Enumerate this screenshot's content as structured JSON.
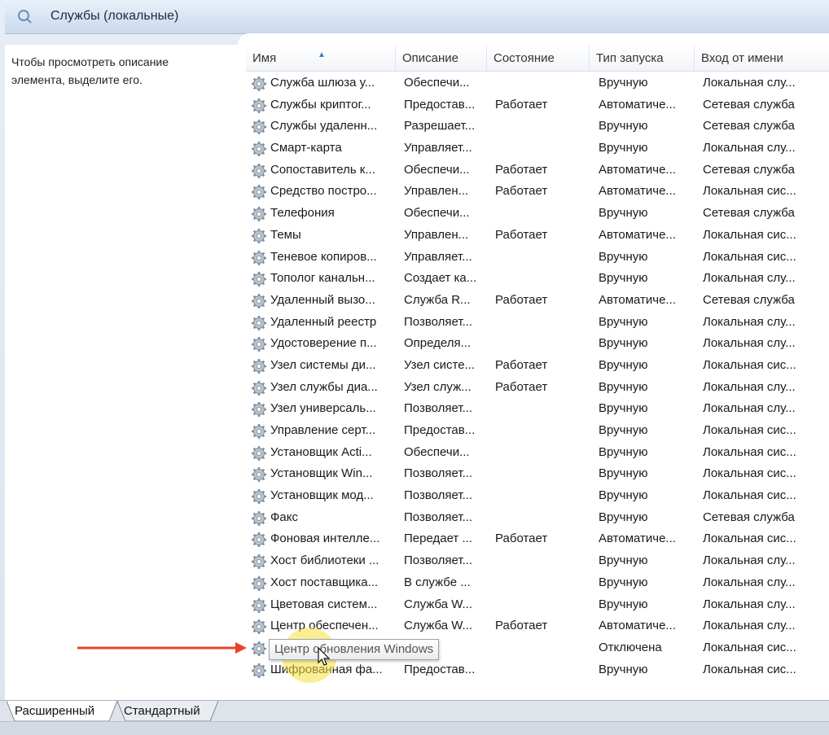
{
  "window": {
    "title": "Службы (локальные)"
  },
  "left_pane": {
    "description": "Чтобы просмотреть описание\nэлемента, выделите его."
  },
  "table": {
    "columns": [
      "Имя",
      "Описание",
      "Состояние",
      "Тип запуска",
      "Вход от имени"
    ],
    "rows": [
      [
        "Служба шлюза у...",
        "Обеспечи...",
        "",
        "Вручную",
        "Локальная слу..."
      ],
      [
        "Службы криптог...",
        "Предостав...",
        "Работает",
        "Автоматиче...",
        "Сетевая служба"
      ],
      [
        "Службы удаленн...",
        "Разрешает...",
        "",
        "Вручную",
        "Сетевая служба"
      ],
      [
        "Смарт-карта",
        "Управляет...",
        "",
        "Вручную",
        "Локальная слу..."
      ],
      [
        "Сопоставитель к...",
        "Обеспечи...",
        "Работает",
        "Автоматиче...",
        "Сетевая служба"
      ],
      [
        "Средство постро...",
        "Управлен...",
        "Работает",
        "Автоматиче...",
        "Локальная сис..."
      ],
      [
        "Телефония",
        "Обеспечи...",
        "",
        "Вручную",
        "Сетевая служба"
      ],
      [
        "Темы",
        "Управлен...",
        "Работает",
        "Автоматиче...",
        "Локальная сис..."
      ],
      [
        "Теневое копиров...",
        "Управляет...",
        "",
        "Вручную",
        "Локальная сис..."
      ],
      [
        "Тополог канальн...",
        "Создает ка...",
        "",
        "Вручную",
        "Локальная слу..."
      ],
      [
        "Удаленный вызо...",
        "Служба R...",
        "Работает",
        "Автоматиче...",
        "Сетевая служба"
      ],
      [
        "Удаленный реестр",
        "Позволяет...",
        "",
        "Вручную",
        "Локальная слу..."
      ],
      [
        "Удостоверение п...",
        "Определя...",
        "",
        "Вручную",
        "Локальная слу..."
      ],
      [
        "Узел системы ди...",
        "Узел систе...",
        "Работает",
        "Вручную",
        "Локальная сис..."
      ],
      [
        "Узел службы диа...",
        "Узел служ...",
        "Работает",
        "Вручную",
        "Локальная слу..."
      ],
      [
        "Узел универсаль...",
        "Позволяет...",
        "",
        "Вручную",
        "Локальная слу..."
      ],
      [
        "Управление серт...",
        "Предостав...",
        "",
        "Вручную",
        "Локальная сис..."
      ],
      [
        "Установщик Acti...",
        "Обеспечи...",
        "",
        "Вручную",
        "Локальная сис..."
      ],
      [
        "Установщик Win...",
        "Позволяет...",
        "",
        "Вручную",
        "Локальная сис..."
      ],
      [
        "Установщик мод...",
        "Позволяет...",
        "",
        "Вручную",
        "Локальная сис..."
      ],
      [
        "Факс",
        "Позволяет...",
        "",
        "Вручную",
        "Сетевая служба"
      ],
      [
        "Фоновая интелле...",
        "Передает ...",
        "Работает",
        "Автоматиче...",
        "Локальная сис..."
      ],
      [
        "Хост библиотеки ...",
        "Позволяет...",
        "",
        "Вручную",
        "Локальная слу..."
      ],
      [
        "Хост поставщика...",
        "В службе ...",
        "",
        "Вручную",
        "Локальная слу..."
      ],
      [
        "Цветовая систем...",
        "Служба W...",
        "",
        "Вручную",
        "Локальная слу..."
      ],
      [
        "Центр обеспечен...",
        "Служба W...",
        "Работает",
        "Автоматиче...",
        "Локальная слу..."
      ],
      [
        "Центр обновлен...",
        "...",
        "",
        "Отключена",
        "Локальная сис..."
      ],
      [
        "Шифрованная фа...",
        "Предостав...",
        "",
        "Вручную",
        "Локальная сис..."
      ]
    ]
  },
  "tooltip": {
    "text": "Центр обновления Windows"
  },
  "tabs": {
    "extended": "Расширенный",
    "standard": "Стандартный"
  },
  "colors": {
    "annotation_arrow": "#e8442a",
    "cursor_highlight": "#f5e13c"
  }
}
